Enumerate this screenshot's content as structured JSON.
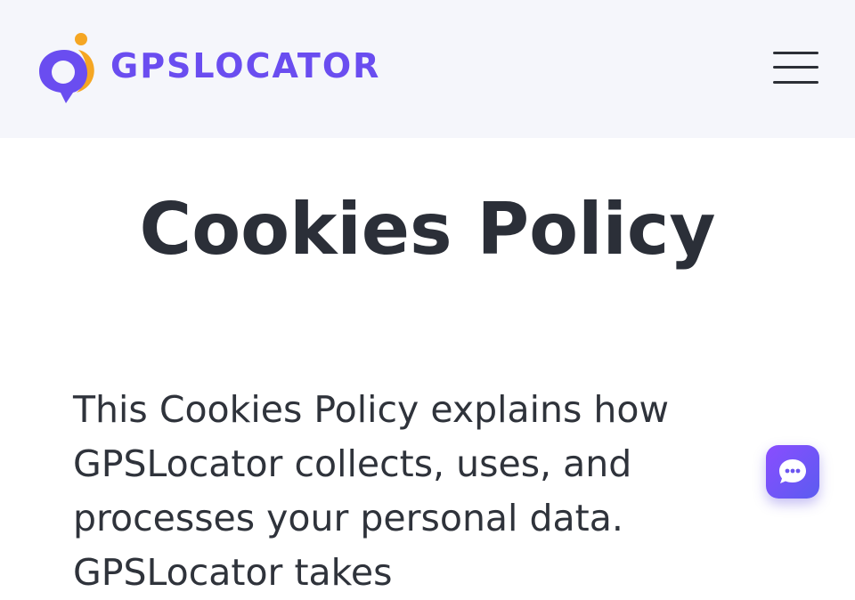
{
  "brand": {
    "name": "GPSLOCATOR",
    "colors": {
      "primary": "#6a4df0",
      "accent": "#f5a623"
    }
  },
  "header": {
    "menu_icon": "hamburger-menu-icon"
  },
  "main": {
    "title": "Cookies Policy",
    "intro": "This Cookies Policy explains how GPSLocator collects, uses, and processes your personal data. GPSLocator takes"
  },
  "chat": {
    "icon": "chat-bubble-icon"
  }
}
